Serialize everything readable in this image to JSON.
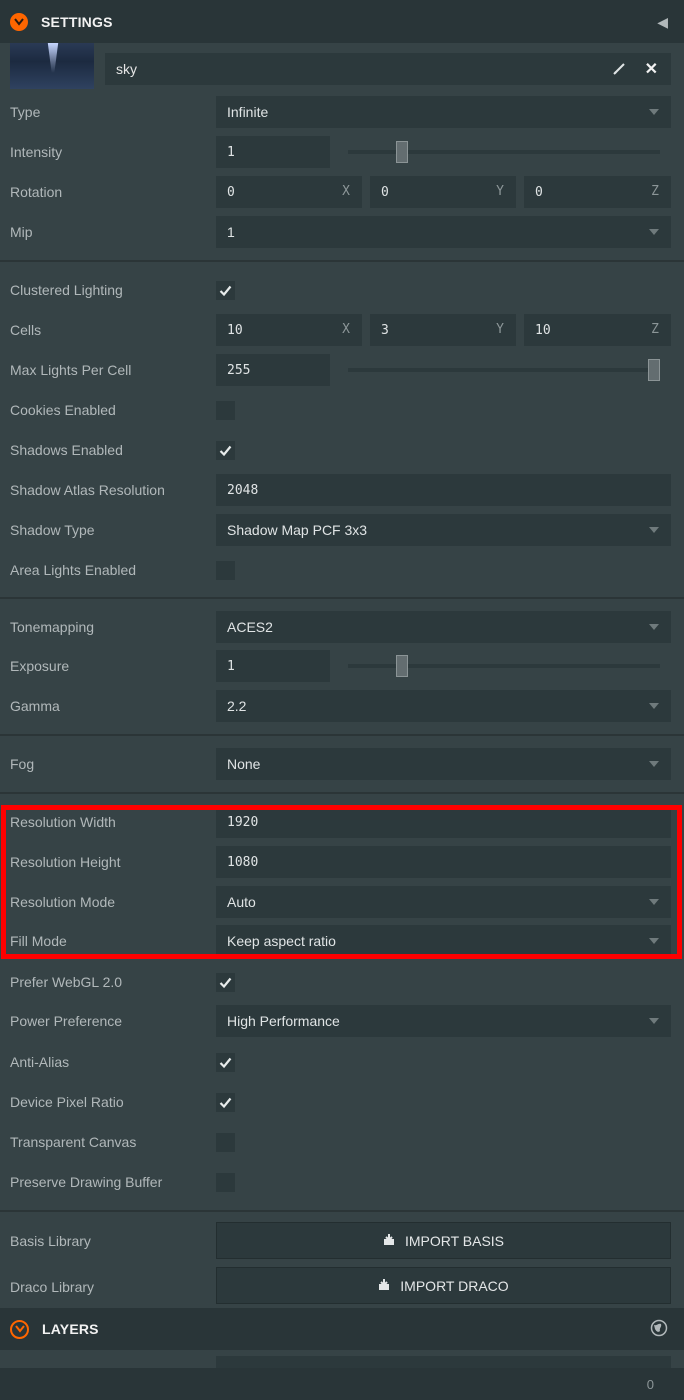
{
  "settings_header": {
    "title": "SETTINGS"
  },
  "skybox": {
    "asset_name": "sky"
  },
  "rows": {
    "type": {
      "label": "Type",
      "value": "Infinite"
    },
    "intensity": {
      "label": "Intensity",
      "value": "1",
      "slider_fraction": 0.16
    },
    "rotation": {
      "label": "Rotation",
      "x": "0",
      "y": "0",
      "z": "0",
      "x_axis": "X",
      "y_axis": "Y",
      "z_axis": "Z"
    },
    "mip": {
      "label": "Mip",
      "value": "1"
    },
    "clustered": {
      "label": "Clustered Lighting",
      "checked": true
    },
    "cells": {
      "label": "Cells",
      "x": "10",
      "y": "3",
      "z": "10",
      "x_axis": "X",
      "y_axis": "Y",
      "z_axis": "Z"
    },
    "max_lights": {
      "label": "Max Lights Per Cell",
      "value": "255",
      "slider_fraction": 1.0
    },
    "cookies": {
      "label": "Cookies Enabled",
      "checked": false
    },
    "shadows": {
      "label": "Shadows Enabled",
      "checked": true
    },
    "shadow_atlas": {
      "label": "Shadow Atlas Resolution",
      "value": "2048"
    },
    "shadow_type": {
      "label": "Shadow Type",
      "value": "Shadow Map PCF 3x3"
    },
    "area_lights": {
      "label": "Area Lights Enabled",
      "checked": false
    },
    "tonemapping": {
      "label": "Tonemapping",
      "value": "ACES2"
    },
    "exposure": {
      "label": "Exposure",
      "value": "1",
      "slider_fraction": 0.16
    },
    "gamma": {
      "label": "Gamma",
      "value": "2.2"
    },
    "fog": {
      "label": "Fog",
      "value": "None"
    },
    "res_width": {
      "label": "Resolution Width",
      "value": "1920"
    },
    "res_height": {
      "label": "Resolution Height",
      "value": "1080"
    },
    "res_mode": {
      "label": "Resolution Mode",
      "value": "Auto"
    },
    "fill_mode": {
      "label": "Fill Mode",
      "value": "Keep aspect ratio"
    },
    "webgl2": {
      "label": "Prefer WebGL 2.0",
      "checked": true
    },
    "power": {
      "label": "Power Preference",
      "value": "High Performance"
    },
    "antialias": {
      "label": "Anti-Alias",
      "checked": true
    },
    "dpr": {
      "label": "Device Pixel Ratio",
      "checked": true
    },
    "transparent": {
      "label": "Transparent Canvas",
      "checked": false
    },
    "preserve": {
      "label": "Preserve Drawing Buffer",
      "checked": false
    },
    "basis": {
      "label": "Basis Library",
      "button": "IMPORT BASIS"
    },
    "draco": {
      "label": "Draco Library",
      "button": "IMPORT DRACO"
    }
  },
  "layers_header": {
    "title": "LAYERS"
  },
  "footer": {
    "count": "0"
  },
  "colors": {
    "accent": "#ff6600",
    "highlight": "#ff0000",
    "panel": "#364346",
    "field": "#2c393c"
  }
}
